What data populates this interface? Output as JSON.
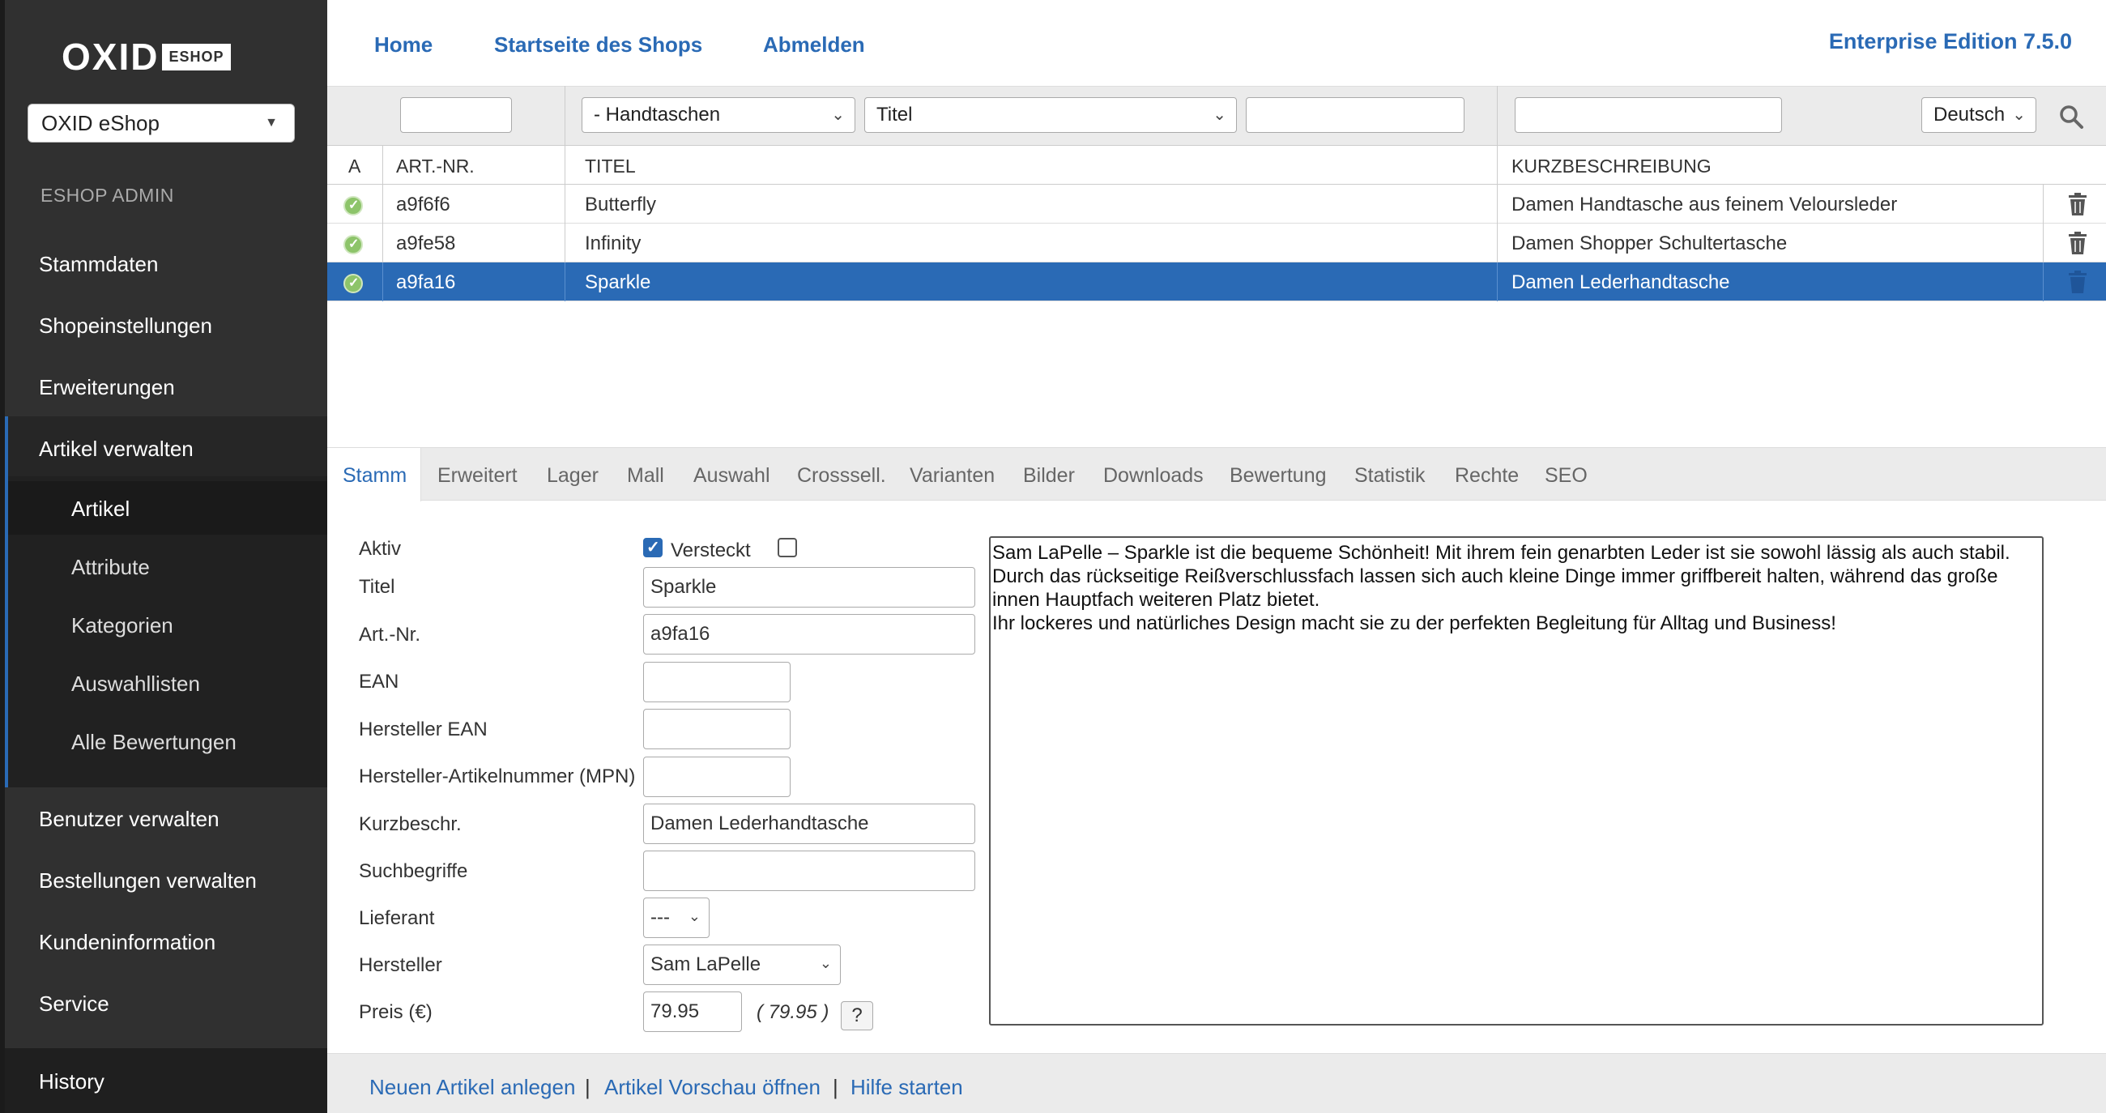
{
  "sidebar": {
    "logo_text": "OXID",
    "logo_badge": "ESHOP",
    "shop_select": "OXID eShop",
    "admin_label": "ESHOP ADMIN",
    "items": [
      {
        "label": "Stammdaten"
      },
      {
        "label": "Shopeinstellungen"
      },
      {
        "label": "Erweiterungen"
      },
      {
        "label": "Artikel verwalten"
      },
      {
        "label": "Benutzer verwalten"
      },
      {
        "label": "Bestellungen verwalten"
      },
      {
        "label": "Kundeninformation"
      },
      {
        "label": "Service"
      },
      {
        "label": "History"
      }
    ],
    "subitems": [
      {
        "label": "Artikel"
      },
      {
        "label": "Attribute"
      },
      {
        "label": "Kategorien"
      },
      {
        "label": "Auswahllisten"
      },
      {
        "label": "Alle Bewertungen"
      }
    ]
  },
  "topnav": {
    "home": "Home",
    "startseite": "Startseite des Shops",
    "abmelden": "Abmelden",
    "edition": "Enterprise Edition 7.5.0"
  },
  "filter": {
    "category_select": "- Handtaschen",
    "field_select": "Titel",
    "language_select": "Deutsch"
  },
  "list": {
    "headers": {
      "active": "A",
      "artnum": "ART.-NR.",
      "title": "TITEL",
      "short": "KURZBESCHREIBUNG"
    },
    "rows": [
      {
        "artnum": "a9f6f6",
        "title": "Butterfly",
        "short": "Damen Handtasche aus feinem Veloursleder"
      },
      {
        "artnum": "a9fe58",
        "title": "Infinity",
        "short": "Damen Shopper Schultertasche"
      },
      {
        "artnum": "a9fa16",
        "title": "Sparkle",
        "short": "Damen Lederhandtasche"
      }
    ]
  },
  "tabs": [
    "Stamm",
    "Erweitert",
    "Lager",
    "Mall",
    "Auswahl",
    "Crosssell.",
    "Varianten",
    "Bilder",
    "Downloads",
    "Bewertung",
    "Statistik",
    "Rechte",
    "SEO"
  ],
  "form": {
    "labels": {
      "aktiv": "Aktiv",
      "versteckt": "Versteckt",
      "titel": "Titel",
      "artnr": "Art.-Nr.",
      "ean": "EAN",
      "hersteller_ean": "Hersteller EAN",
      "mpn": "Hersteller-Artikelnummer (MPN)",
      "kurzbeschr": "Kurzbeschr.",
      "suchbegriffe": "Suchbegriffe",
      "lieferant": "Lieferant",
      "hersteller": "Hersteller",
      "preis": "Preis (€)"
    },
    "values": {
      "titel": "Sparkle",
      "artnr": "a9fa16",
      "ean": "",
      "hersteller_ean": "",
      "mpn": "",
      "kurzbeschr": "Damen Lederhandtasche",
      "suchbegriffe": "",
      "lieferant": "---",
      "hersteller": "Sam LaPelle",
      "preis": "79.95",
      "preis_brutto": "( 79.95 )",
      "help": "?"
    },
    "description": [
      "Sam LaPelle – Sparkle ist die bequeme Schönheit! Mit ihrem fein genarbten Leder ist sie sowohl lässig als auch stabil.",
      "Durch das rückseitige Reißverschlussfach lassen sich auch kleine Dinge immer griffbereit halten, während das große innen Hauptfach weiteren Platz bietet.",
      "Ihr lockeres und natürliches Design macht sie zu der perfekten Begleitung für Alltag und Business!"
    ]
  },
  "footer": {
    "new_article": "Neuen Artikel anlegen",
    "preview": "Artikel Vorschau öffnen",
    "help": "Hilfe starten",
    "sep": "|"
  },
  "colors": {
    "accent": "#2a6ab5",
    "sidebar": "#303030",
    "active_dot": "#8dc46a"
  }
}
